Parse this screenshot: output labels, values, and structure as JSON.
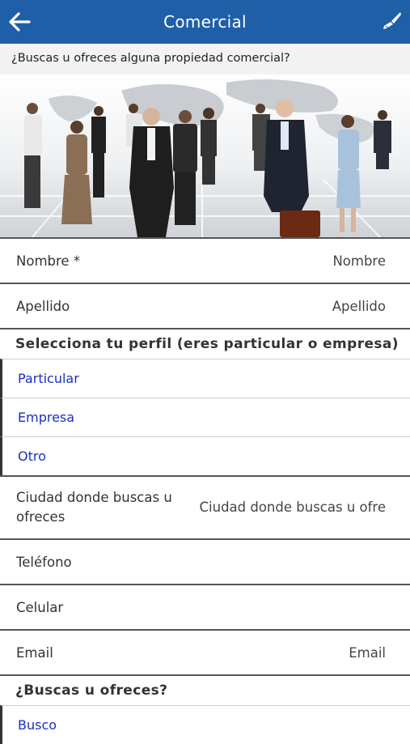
{
  "header": {
    "title": "Comercial",
    "back_icon": "arrow-left-icon",
    "action_icon": "paint-brush-icon",
    "color": "#1f5fa8"
  },
  "subtitle": "¿Buscas u ofreces alguna propiedad comercial?",
  "form": {
    "nombre": {
      "label": "Nombre *",
      "placeholder": "Nombre"
    },
    "apellido": {
      "label": "Apellido",
      "placeholder": "Apellido"
    },
    "perfil": {
      "title": "Selecciona tu perfil (eres particular o empresa)",
      "options": [
        "Particular",
        "Empresa",
        "Otro"
      ]
    },
    "ciudad": {
      "label": "Ciudad donde buscas u ofreces",
      "placeholder": "Ciudad donde buscas u ofre"
    },
    "telefono": {
      "label": "Teléfono"
    },
    "celular": {
      "label": "Celular"
    },
    "email": {
      "label": "Email",
      "placeholder": "Email"
    },
    "busca": {
      "title": "¿Buscas u ofreces?",
      "options": [
        "Busco"
      ]
    }
  },
  "option_color": "#1a2fc2"
}
